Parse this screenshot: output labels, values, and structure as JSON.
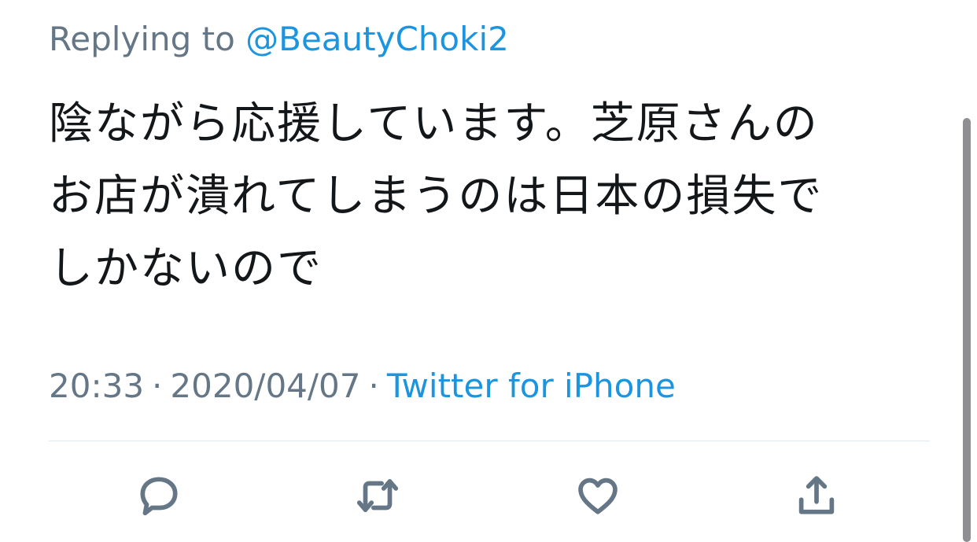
{
  "reply": {
    "prefix": "Replying to ",
    "handle": "@BeautyChoki2"
  },
  "tweet": {
    "lines": [
      "陰ながら応援しています。芝原さんの",
      "お店が潰れてしまうのは日本の損失で",
      "しかないので"
    ]
  },
  "meta": {
    "time": "20:33",
    "separator": "·",
    "date": "2020/04/07",
    "source": "Twitter for iPhone"
  },
  "actions": [
    {
      "name": "reply",
      "icon": "comment-bubble-icon"
    },
    {
      "name": "retweet",
      "icon": "retweet-icon"
    },
    {
      "name": "like",
      "icon": "heart-icon"
    },
    {
      "name": "share",
      "icon": "share-icon"
    }
  ],
  "colors": {
    "text": "#14171a",
    "muted": "#657786",
    "link": "#1b95e0",
    "divider": "#e1e8ed"
  }
}
